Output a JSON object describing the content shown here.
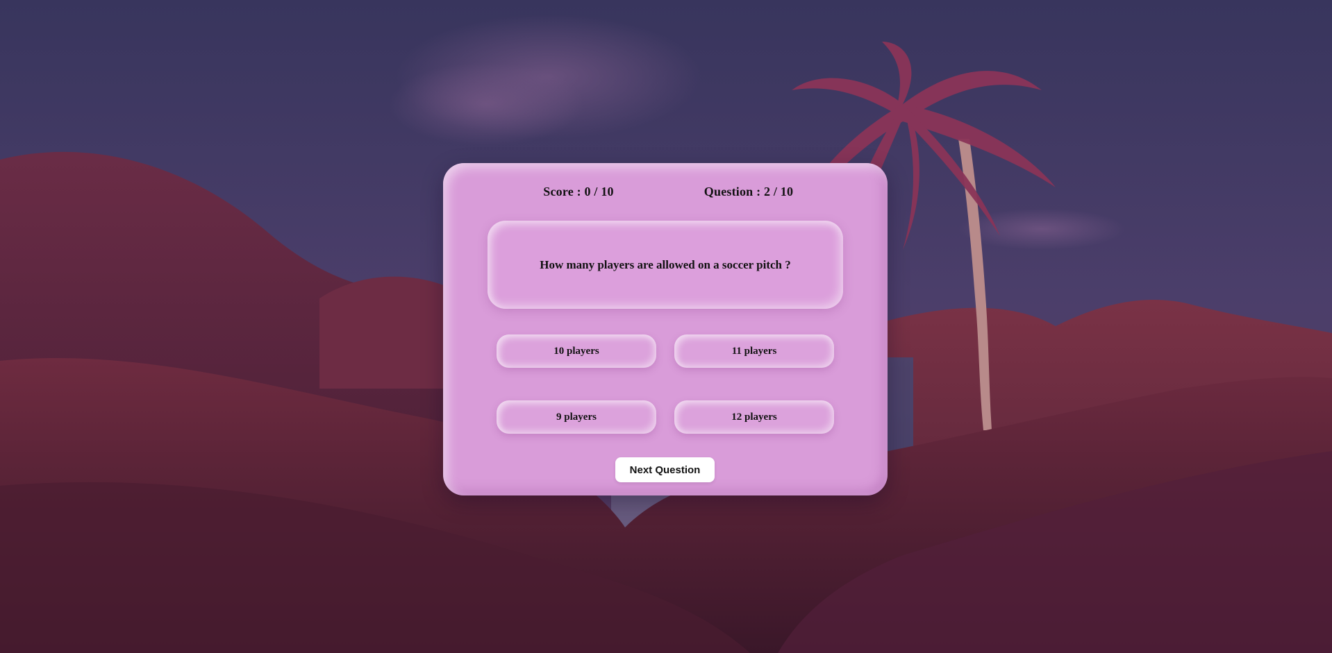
{
  "quiz": {
    "score_text": "Score : 0 / 10",
    "question_counter_text": "Question : 2 / 10",
    "question": "How many players are allowed on a soccer pitch ?",
    "answers": [
      {
        "label": "10 players"
      },
      {
        "label": "11 players"
      },
      {
        "label": "9 players"
      },
      {
        "label": "12 players"
      }
    ],
    "next_button_label": "Next Question"
  },
  "colors": {
    "card_background": "#d99cd9",
    "button_background": "#ffffff",
    "text": "#111111",
    "sky": "#3f3a66",
    "grass": "#6e2b3f"
  }
}
